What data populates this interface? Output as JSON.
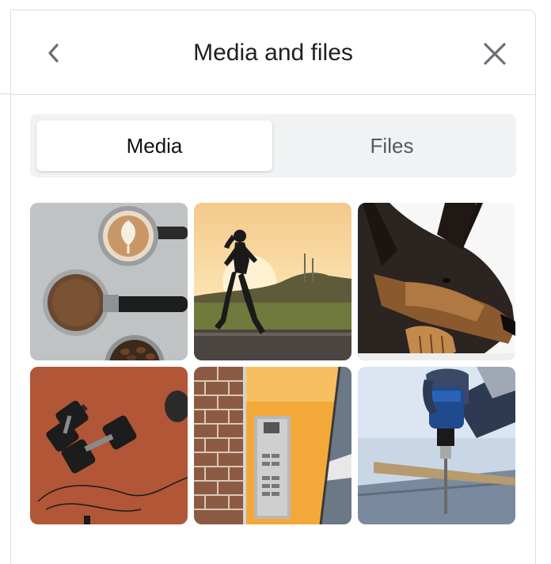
{
  "header": {
    "title": "Media and files",
    "back_icon": "chevron-left-icon",
    "close_icon": "close-icon"
  },
  "tabs": [
    {
      "label": "Media",
      "active": true
    },
    {
      "label": "Files",
      "active": false
    }
  ],
  "media": [
    {
      "subject": "coffee-and-espresso-portafilters"
    },
    {
      "subject": "runner-at-sunset"
    },
    {
      "subject": "german-shepherd-dog"
    },
    {
      "subject": "dumbbells-on-running-track"
    },
    {
      "subject": "intercom-panel-on-yellow-wall"
    },
    {
      "subject": "hand-with-power-drill"
    }
  ],
  "colors": {
    "border": "#dcdcdc",
    "tab_bar_bg": "#f1f2f4",
    "active_tab_bg": "#ffffff",
    "inactive_tab_text": "#555a60",
    "icon": "#6b6f75"
  }
}
